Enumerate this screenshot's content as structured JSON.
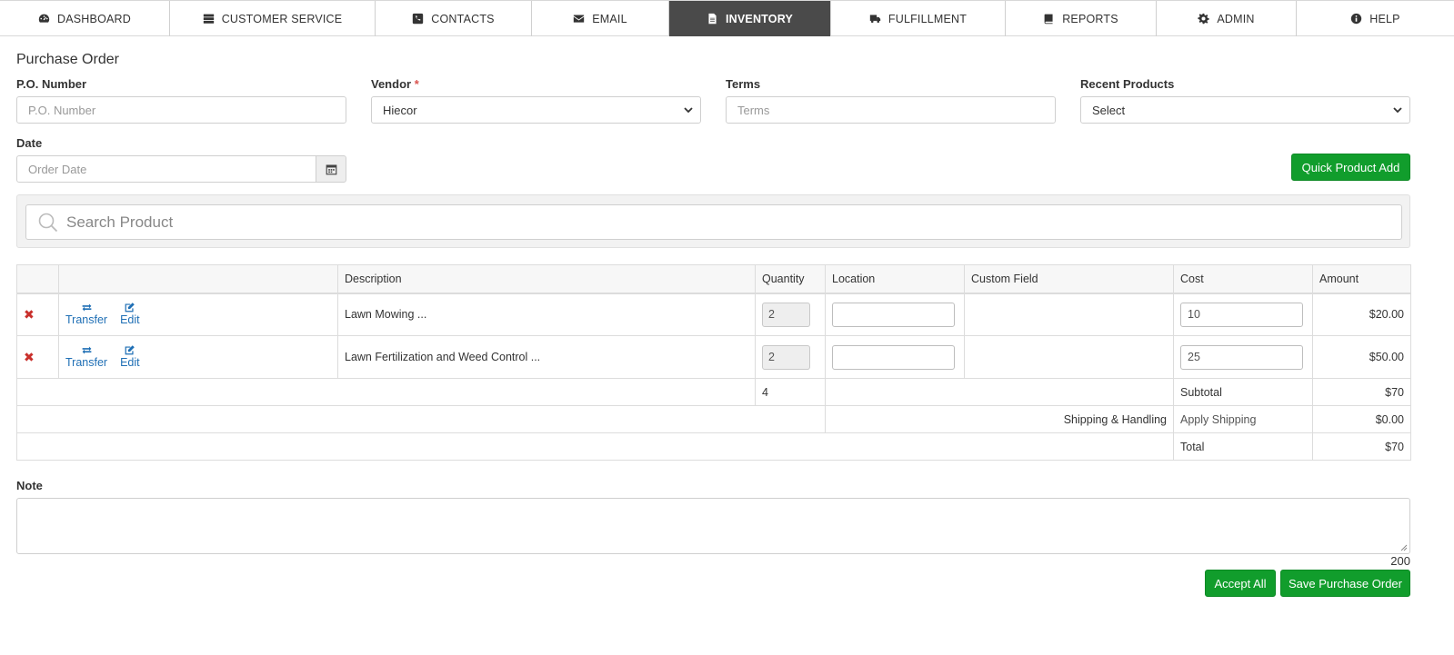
{
  "nav": {
    "items": [
      {
        "label": "DASHBOARD",
        "icon": "dashboard-icon"
      },
      {
        "label": "CUSTOMER SERVICE",
        "icon": "server-icon"
      },
      {
        "label": "CONTACTS",
        "icon": "phone-icon"
      },
      {
        "label": "EMAIL",
        "icon": "envelope-icon"
      },
      {
        "label": "INVENTORY",
        "icon": "file-icon"
      },
      {
        "label": "FULFILLMENT",
        "icon": "truck-icon"
      },
      {
        "label": "REPORTS",
        "icon": "book-icon"
      },
      {
        "label": "ADMIN",
        "icon": "gear-icon"
      },
      {
        "label": "HELP",
        "icon": "info-icon"
      }
    ],
    "active": "INVENTORY"
  },
  "page": {
    "title": "Purchase Order"
  },
  "form": {
    "po_number": {
      "label": "P.O. Number",
      "placeholder": "P.O. Number",
      "value": ""
    },
    "vendor": {
      "label": "Vendor",
      "required_mark": "*",
      "value": "Hiecor"
    },
    "terms": {
      "label": "Terms",
      "placeholder": "Terms",
      "value": ""
    },
    "recent_products": {
      "label": "Recent Products",
      "value": "Select"
    },
    "date": {
      "label": "Date",
      "placeholder": "Order Date",
      "value": ""
    },
    "quick_add_label": "Quick Product Add"
  },
  "search": {
    "placeholder": "Search Product"
  },
  "table": {
    "headers": [
      "",
      "",
      "Description",
      "Quantity",
      "Location",
      "Custom Field",
      "Cost",
      "Amount"
    ],
    "transfer_label": "Transfer",
    "edit_label": "Edit",
    "rows": [
      {
        "description": "Lawn Mowing ...",
        "quantity": "2",
        "location": "",
        "custom": "",
        "cost": "10",
        "amount": "$20.00"
      },
      {
        "description": "Lawn Fertilization and Weed Control ...",
        "quantity": "2",
        "location": "",
        "custom": "",
        "cost": "25",
        "amount": "$50.00"
      }
    ],
    "total_quantity": "4",
    "subtotal_label": "Subtotal",
    "subtotal_value": "$70",
    "shipping_label": "Shipping & Handling",
    "apply_shipping_label": "Apply Shipping",
    "shipping_value": "$0.00",
    "total_label": "Total",
    "total_value": "$70"
  },
  "note": {
    "label": "Note",
    "value": "",
    "char_count": "200"
  },
  "buttons": {
    "accept_all": "Accept All",
    "save": "Save Purchase Order"
  },
  "colors": {
    "accent_green": "#119d2c",
    "nav_active_bg": "#4a4a4a",
    "link_blue": "#1f6fb5",
    "delete_red": "#c9302c"
  }
}
